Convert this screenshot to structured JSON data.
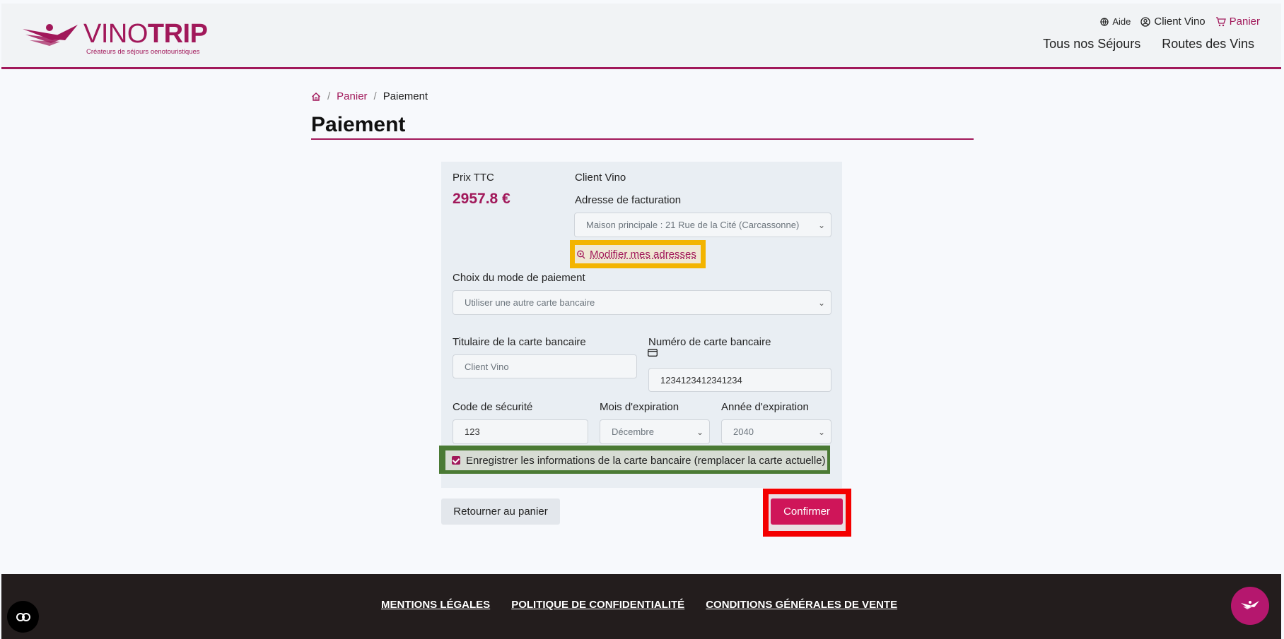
{
  "brand": {
    "name_thin": "VINO",
    "name_bold": "TRIP",
    "tagline": "Créateurs de séjours oenotouristiques",
    "color": "#a1185a"
  },
  "header": {
    "top_links": {
      "help": "Aide",
      "account": "Client Vino",
      "cart": "Panier"
    },
    "nav": {
      "stays": "Tous nos Séjours",
      "wine_routes": "Routes des Vins"
    }
  },
  "breadcrumb": {
    "home_icon": "home-icon",
    "cart": "Panier",
    "current": "Paiement"
  },
  "page": {
    "title": "Paiement"
  },
  "payment": {
    "price_label": "Prix TTC",
    "price_value": "2957.8 €",
    "client_name": "Client Vino",
    "billing_label": "Adresse de facturation",
    "billing_selected": "Maison principale : 21 Rue de la Cité (Carcassonne)",
    "modify_addresses": "Modifier mes adresses",
    "method_label": "Choix du mode de paiement",
    "method_selected": "Utiliser une autre carte bancaire",
    "holder_label": "Titulaire de la carte bancaire",
    "holder_placeholder": "Client Vino",
    "number_label": "Numéro de carte bancaire",
    "number_value": "1234123412341234",
    "cvc_label": "Code de sécurité",
    "cvc_value": "123",
    "month_label": "Mois d'expiration",
    "month_selected": "Décembre",
    "year_label": "Année d'expiration",
    "year_selected": "2040",
    "save_card_label": "Enregistrer les informations de la carte bancaire (remplacer la carte actuelle)",
    "save_card_checked": true
  },
  "actions": {
    "back": "Retourner au panier",
    "confirm": "Confirmer"
  },
  "footer": {
    "legal": "MENTIONS LÉGALES",
    "privacy": "POLITIQUE DE CONFIDENTIALITÉ",
    "terms": "CONDITIONS GÉNÉRALES DE VENTE"
  }
}
